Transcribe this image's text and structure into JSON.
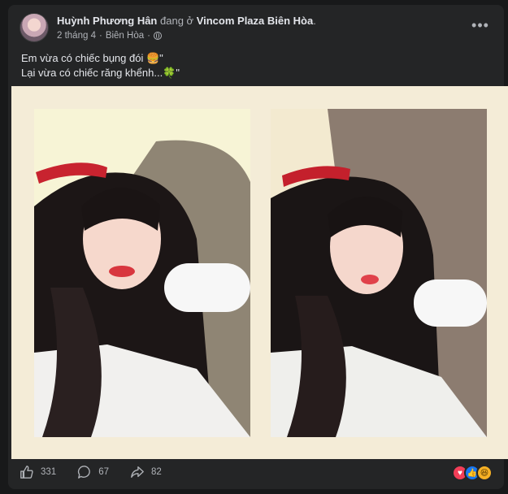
{
  "post": {
    "author": "Huỳnh Phương Hân",
    "checkin_prefix": "đang ở",
    "location": "Vincom Plaza Biên Hòa",
    "location_suffix": ".",
    "date": "2 tháng 4",
    "separator": "·",
    "city": "Biên Hòa",
    "more_icon": "more-horizontal-icon",
    "privacy_icon": "globe-icon",
    "lines": [
      "Em vừa có chiếc bụng đói 🍔\"",
      "Lại vừa có chiếc răng khểnh...🍀\""
    ]
  },
  "stats": {
    "likes": "331",
    "comments": "67",
    "shares": "82"
  },
  "reactions": [
    {
      "name": "love",
      "color": "#f33e58"
    },
    {
      "name": "like",
      "color": "#1877f2"
    },
    {
      "name": "haha",
      "color": "#f7b125"
    }
  ]
}
